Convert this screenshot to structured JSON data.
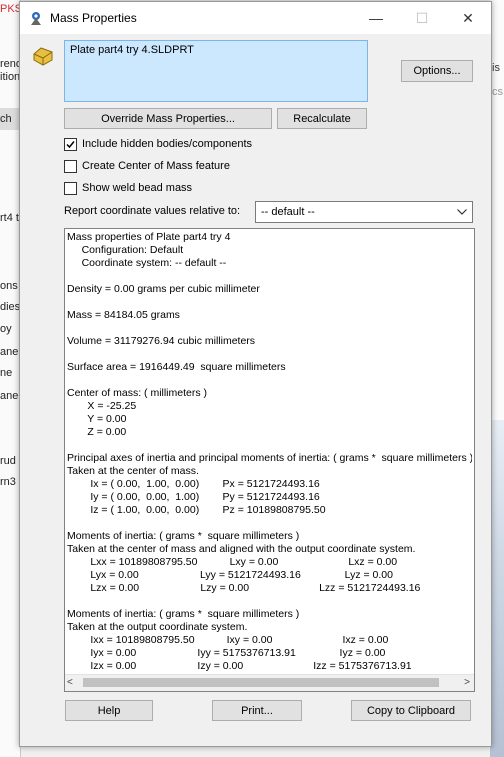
{
  "window": {
    "title": "Mass Properties",
    "minimize_glyph": "—",
    "maximize_glyph": "☐",
    "close_glyph": "✕"
  },
  "background_left_fragments": [
    "PKS",
    "rend",
    "ition",
    "ch",
    "rt4 t",
    "ons",
    "dies",
    "oy",
    "ane",
    "ne",
    "ane",
    "rud",
    "rn3"
  ],
  "background_right_fragments": [
    "is",
    "cs"
  ],
  "part_name": "Plate part4 try 4.SLDPRT",
  "buttons": {
    "options": "Options...",
    "override": "Override Mass Properties...",
    "recalculate": "Recalculate",
    "help": "Help",
    "print": "Print...",
    "copy": "Copy to Clipboard"
  },
  "options": {
    "include_hidden": {
      "label": "Include hidden bodies/components",
      "checked": true
    },
    "create_com": {
      "label": "Create Center of Mass feature",
      "checked": false
    },
    "weld_bead": {
      "label": "Show weld bead mass",
      "checked": false
    }
  },
  "coordinate_system": {
    "label": "Report coordinate values relative to:",
    "value": "-- default --"
  },
  "results_text": "Mass properties of Plate part4 try 4\n     Configuration: Default\n     Coordinate system: -- default --\n\nDensity = 0.00 grams per cubic millimeter\n\nMass = 84184.05 grams\n\nVolume = 31179276.94 cubic millimeters\n\nSurface area = 1916449.49  square millimeters\n\nCenter of mass: ( millimeters )\n       X = -25.25\n       Y = 0.00\n       Z = 0.00\n\nPrincipal axes of inertia and principal moments of inertia: ( grams *  square millimeters )\nTaken at the center of mass.\n        Ix = ( 0.00,  1.00,  0.00)        Px = 5121724493.16\n        Iy = ( 0.00,  0.00,  1.00)        Py = 5121724493.16\n        Iz = ( 1.00,  0.00,  0.00)        Pz = 10189808795.50\n\nMoments of inertia: ( grams *  square millimeters )\nTaken at the center of mass and aligned with the output coordinate system.\n        Lxx = 10189808795.50           Lxy = 0.00                        Lxz = 0.00\n        Lyx = 0.00                     Lyy = 5121724493.16               Lyz = 0.00\n        Lzx = 0.00                     Lzy = 0.00                        Lzz = 5121724493.16\n\nMoments of inertia: ( grams *  square millimeters )\nTaken at the output coordinate system.\n        Ixx = 10189808795.50           Ixy = 0.00                        Ixz = 0.00\n        Iyx = 0.00                     Iyy = 5175376713.91               Iyz = 0.00\n        Izx = 0.00                     Izy = 0.00                        Izz = 5175376713.91",
  "scroll_arrows": {
    "left": "<",
    "right": ">"
  },
  "colors": {
    "accent": "#0078d7",
    "name_box_bg": "#cce8ff",
    "name_box_border": "#7eb4ea"
  },
  "icons": {
    "title": "mass-properties-icon",
    "part": "part-icon"
  }
}
